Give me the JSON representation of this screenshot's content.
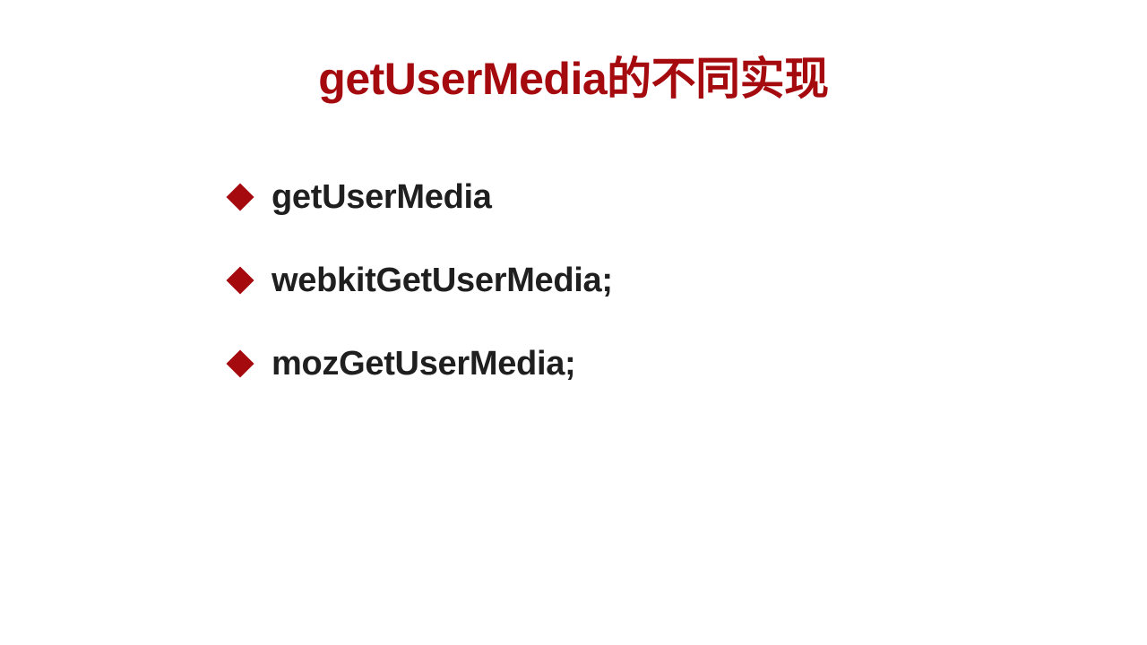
{
  "slide": {
    "title": "getUserMedia的不同实现",
    "accent_color": "#A50A0F",
    "bullet_icon": "diamond-icon",
    "bullets": [
      {
        "text": "getUserMedia"
      },
      {
        "text": "webkitGetUserMedia;"
      },
      {
        "text": "mozGetUserMedia;"
      }
    ]
  }
}
